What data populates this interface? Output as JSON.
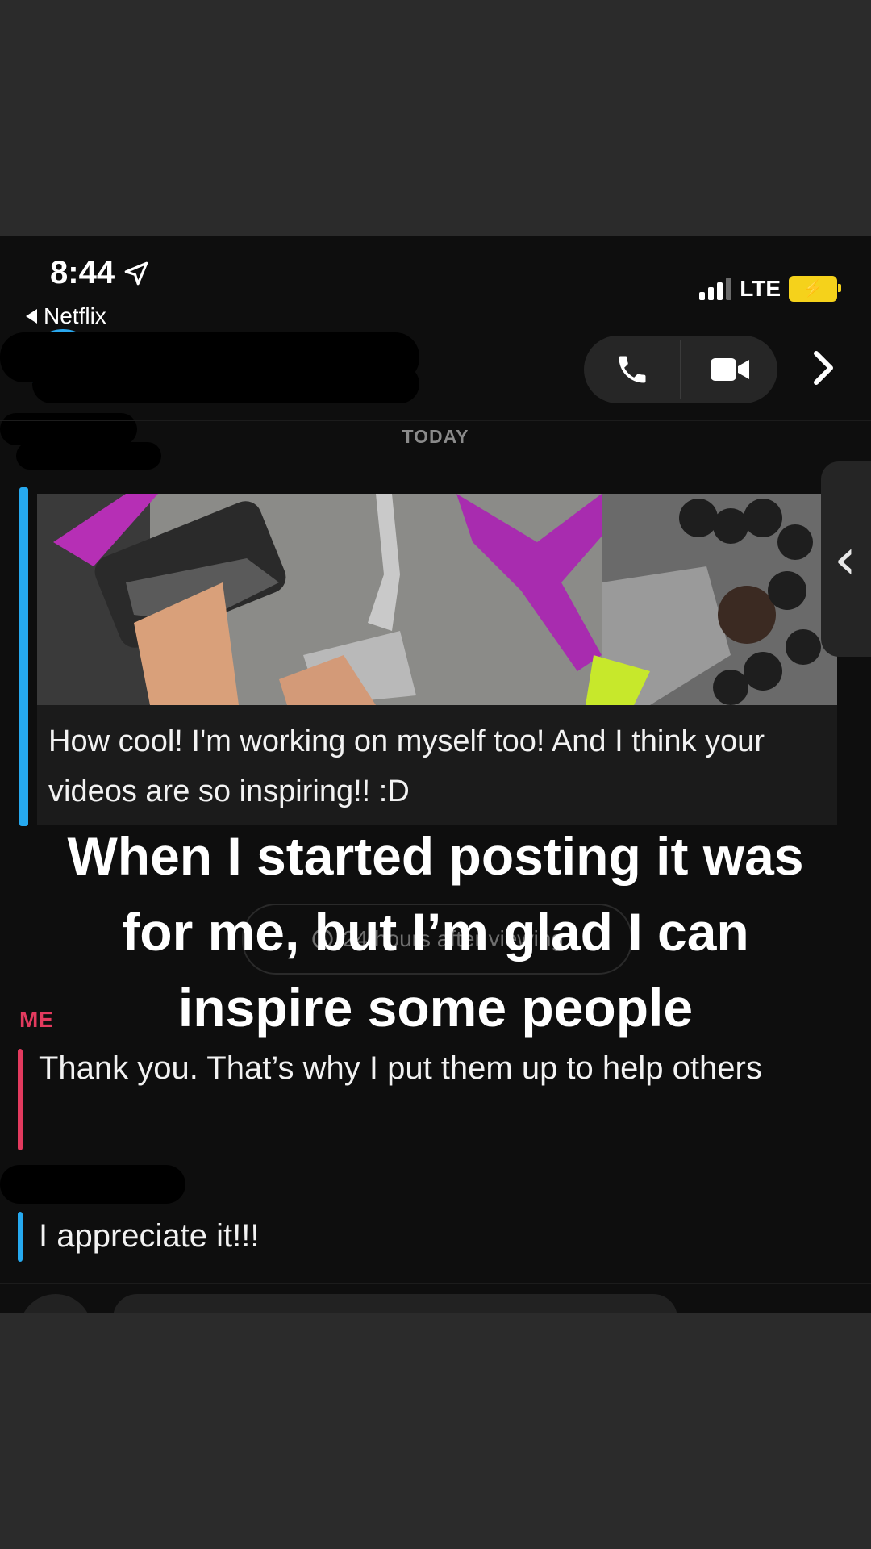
{
  "status_bar": {
    "time": "8:44",
    "network": "LTE"
  },
  "back_app": "Netflix",
  "header": {
    "day_label": "TODAY"
  },
  "story_reply": {
    "caption": "How cool! I'm working on myself too! And I think your videos are so inspiring!! :D"
  },
  "overlay_caption": "When I started posting it was for me, but I’m glad I can inspire some people",
  "viewing_pill": "24 hours after viewing",
  "messages": {
    "me_label": "ME",
    "me_text": "Thank you. That’s why I put them up to help others",
    "them_text": "I appreciate it!!!"
  },
  "colors": {
    "accent_blue": "#26a9ef",
    "me_red": "#e33a5e",
    "battery": "#f5d21b"
  },
  "icons": [
    "location-arrow-icon",
    "back-triangle-icon",
    "signal-icon",
    "battery-charging-icon",
    "phone-icon",
    "video-camera-icon",
    "chevron-right-icon",
    "chevron-left-icon",
    "clock-icon"
  ]
}
